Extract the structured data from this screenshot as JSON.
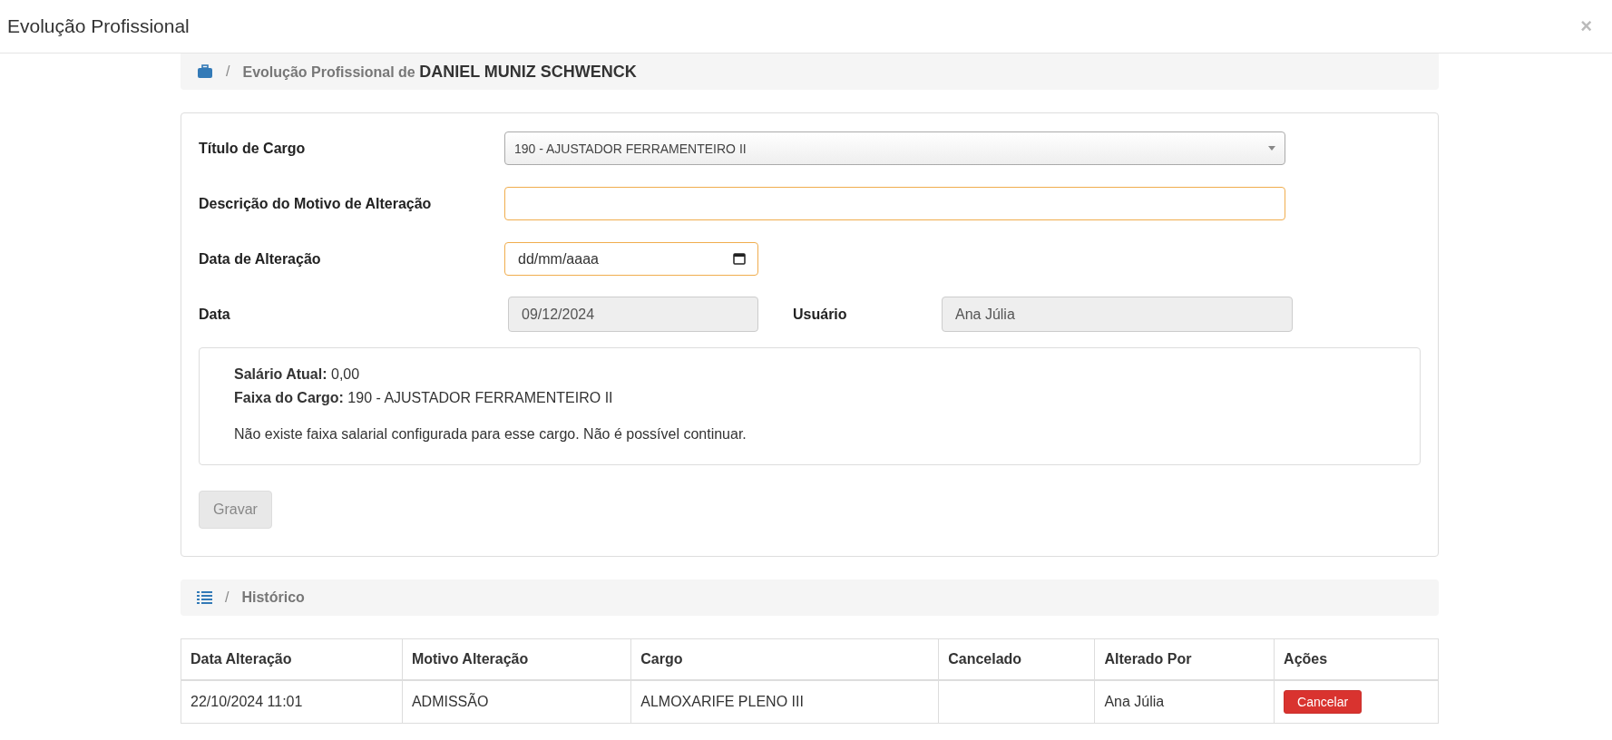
{
  "window": {
    "title": "Evolução Profissional",
    "close": "×"
  },
  "breadcrumb": {
    "separator": "/",
    "prefix": "Evolução Profissional de",
    "name": "DANIEL MUNIZ SCHWENCK"
  },
  "form": {
    "fields": [
      {
        "kind": "select",
        "label": "Título de Cargo",
        "value": "190 - AJUSTADOR FERRAMENTEIRO II"
      },
      {
        "kind": "text",
        "label": "Descrição do Motivo de Alteração"
      },
      {
        "kind": "date",
        "label": "Data de Alteração",
        "placeholder": "dd/mm/aaaa"
      }
    ],
    "readonly": [
      {
        "label": "Data",
        "value": "09/12/2024"
      },
      {
        "label": "Usuário",
        "value": "Ana Júlia"
      }
    ],
    "info": {
      "lines": [
        "**Salário Atual:** 0,00",
        "**Faixa do Cargo:** 190 - AJUSTADOR FERRAMENTEIRO II"
      ],
      "message": "Não existe faixa salarial configurada para esse cargo. Não é possível continuar."
    },
    "save_button": {
      "label": "Gravar",
      "disabled": true
    }
  },
  "history": {
    "separator": "/",
    "title": "Histórico",
    "table": {
      "columns": [
        "Data Alteração",
        "Motivo Alteração",
        "Cargo",
        "Cancelado",
        "Alterado Por",
        "Ações"
      ],
      "rows": [
        {
          "cells": [
            "22/10/2024 11:01",
            "ADMISSÃO",
            "ALMOXARIFE PLENO III",
            "",
            "Ana Júlia"
          ],
          "action": "Cancelar"
        }
      ]
    }
  }
}
